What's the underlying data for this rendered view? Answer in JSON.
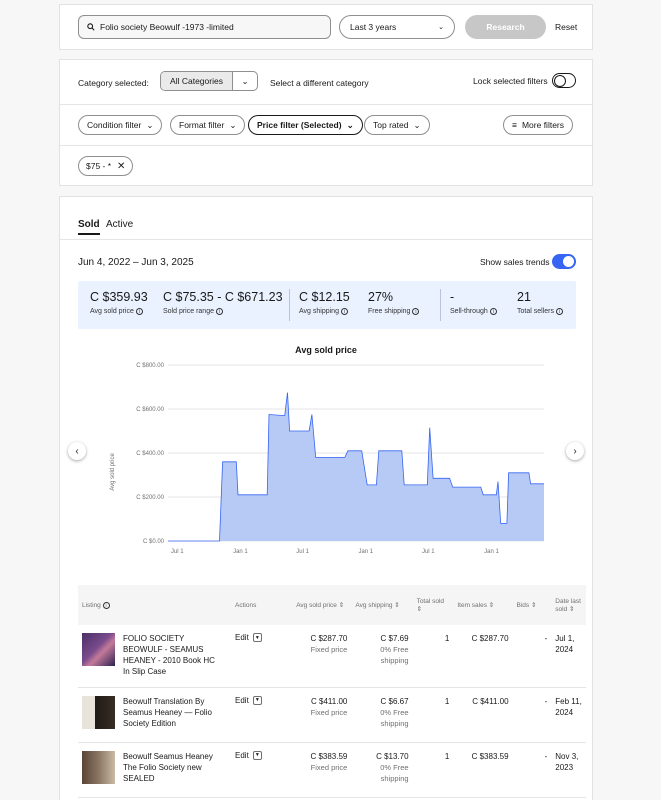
{
  "search": {
    "query": "Folio society Beowulf -1973 -limited",
    "period": "Last 3 years",
    "research_label": "Research",
    "reset_label": "Reset"
  },
  "category": {
    "label": "Category selected:",
    "selected": "All Categories",
    "different": "Select a different category",
    "lock_label": "Lock selected filters"
  },
  "filters": {
    "condition": "Condition filter",
    "format": "Format filter",
    "price": "Price filter (Selected)",
    "top_rated": "Top rated",
    "more": "More filters"
  },
  "chip": {
    "label": "$75 - *"
  },
  "tabs": {
    "sold": "Sold",
    "active": "Active"
  },
  "date_range": "Jun 4, 2022 – Jun 3, 2025",
  "trends_label": "Show sales trends",
  "stats": [
    {
      "value": "C $359.93",
      "label": "Avg sold price"
    },
    {
      "value": "C $75.35 - C $671.23",
      "label": "Sold price range"
    },
    {
      "value": "C $12.15",
      "label": "Avg shipping"
    },
    {
      "value": "27%",
      "label": "Free shipping"
    },
    {
      "value": "-",
      "label": "Sell-through"
    },
    {
      "value": "21",
      "label": "Total sellers"
    }
  ],
  "chart_data": {
    "type": "area",
    "title": "Avg sold price",
    "xlabel": "",
    "ylabel": "Avg sold price",
    "ylim": [
      0,
      800
    ],
    "yticks": [
      "C $0.00",
      "C $200.00",
      "C $400.00",
      "C $600.00",
      "C $800.00"
    ],
    "xticks": [
      "Jul 1",
      "Jan 1",
      "Jul 1",
      "Jan 1",
      "Jul 1",
      "Jan 1"
    ],
    "x_start": "2022-06-04",
    "x_end": "2025-06-03",
    "accent": "#b7c9f5",
    "line_color": "#3665f3",
    "series": [
      {
        "name": "Avg sold price",
        "points": [
          [
            "2022-06-04",
            0
          ],
          [
            "2022-11-01",
            0
          ],
          [
            "2022-11-10",
            360
          ],
          [
            "2022-12-20",
            360
          ],
          [
            "2022-12-25",
            210
          ],
          [
            "2023-03-20",
            210
          ],
          [
            "2023-03-25",
            575
          ],
          [
            "2023-05-10",
            570
          ],
          [
            "2023-05-18",
            675
          ],
          [
            "2023-05-24",
            500
          ],
          [
            "2023-07-20",
            500
          ],
          [
            "2023-07-28",
            575
          ],
          [
            "2023-08-08",
            380
          ],
          [
            "2023-11-01",
            380
          ],
          [
            "2023-11-10",
            410
          ],
          [
            "2023-12-20",
            410
          ],
          [
            "2024-01-05",
            255
          ],
          [
            "2024-02-01",
            255
          ],
          [
            "2024-02-08",
            410
          ],
          [
            "2024-04-15",
            410
          ],
          [
            "2024-04-22",
            255
          ],
          [
            "2024-06-28",
            255
          ],
          [
            "2024-07-05",
            515
          ],
          [
            "2024-07-15",
            285
          ],
          [
            "2024-09-01",
            285
          ],
          [
            "2024-09-10",
            245
          ],
          [
            "2024-12-01",
            245
          ],
          [
            "2024-12-08",
            210
          ],
          [
            "2025-01-15",
            210
          ],
          [
            "2025-01-20",
            270
          ],
          [
            "2025-01-28",
            80
          ],
          [
            "2025-02-15",
            80
          ],
          [
            "2025-02-20",
            310
          ],
          [
            "2025-04-20",
            310
          ],
          [
            "2025-04-25",
            260
          ],
          [
            "2025-06-03",
            260
          ]
        ]
      }
    ]
  },
  "table": {
    "headers": [
      "Listing",
      "Actions",
      "Avg sold price",
      "Avg shipping",
      "Total sold",
      "Item sales",
      "Bids",
      "Date last sold"
    ],
    "rows": [
      {
        "title": "FOLIO SOCIETY BEOWULF - SEAMUS HEANEY - 2010 Book HC In Slip Case",
        "action": "Edit",
        "price": "C $287.70",
        "price_sub": "Fixed price",
        "shipping": "C $7.69",
        "ship_sub": "0% Free shipping",
        "sold": "1",
        "sales": "C $287.70",
        "bids": "-",
        "date": "Jul 1, 2024"
      },
      {
        "title": "Beowulf Translation By Seamus Heaney — Folio Society Edition",
        "action": "Edit",
        "price": "C $411.00",
        "price_sub": "Fixed price",
        "shipping": "C $6.67",
        "ship_sub": "0% Free shipping",
        "sold": "1",
        "sales": "C $411.00",
        "bids": "-",
        "date": "Feb 11, 2024"
      },
      {
        "title": "Beowulf Seamus Heaney The Folio Society new SEALED",
        "action": "Edit",
        "price": "C $383.59",
        "price_sub": "Fixed price",
        "shipping": "C $13.70",
        "ship_sub": "0% Free shipping",
        "sold": "1",
        "sales": "C $383.59",
        "bids": "-",
        "date": "Nov 3, 2023"
      }
    ]
  }
}
